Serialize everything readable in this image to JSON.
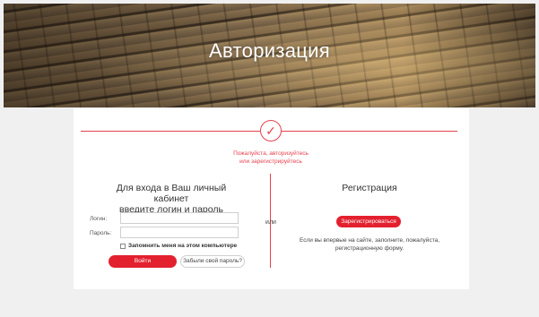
{
  "hero": {
    "title": "Авторизация"
  },
  "notice": {
    "line1": "Пожалуйста, авторизуйтесь",
    "line2": "или зарегистрируйтесь"
  },
  "login": {
    "heading_line1": "Для входа в Ваш личный кабинет",
    "heading_line2": "введите логин и пароль",
    "login_label": "Логин:",
    "login_value": "",
    "password_label": "Пароль:",
    "password_value": "",
    "remember_label": "Запомнить меня на этом компьютере",
    "remember_checked": false,
    "submit_label": "Войти",
    "forgot_label": "Забыли свой пароль?"
  },
  "separator": {
    "or_label": "или"
  },
  "register": {
    "heading": "Регистрация",
    "button_label": "Зарегистрироваться",
    "text_line1": "Если вы впервые на сайте, заполните, пожалуйста,",
    "text_line2": "регистрационную форму."
  },
  "colors": {
    "accent": "#e3202e",
    "divider": "#e5414e",
    "page_background": "#f0f0f1",
    "card_background": "#ffffff"
  },
  "icons": {
    "status": "check-circle-icon"
  }
}
